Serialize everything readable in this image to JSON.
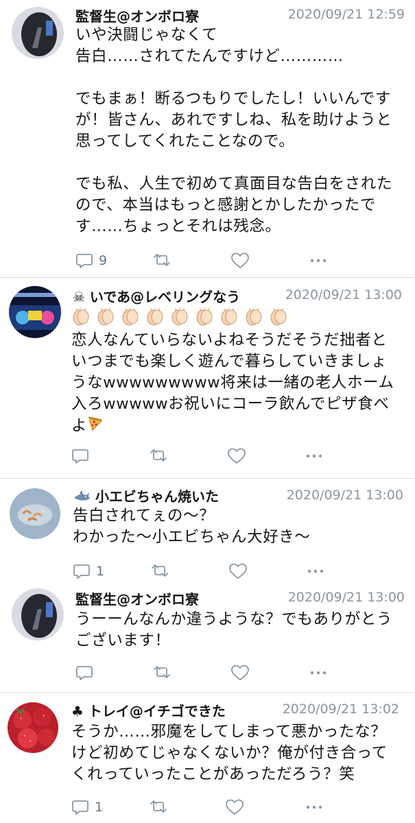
{
  "tweets": [
    {
      "name": "監督生@オンボロ寮",
      "time": "2020/09/21 12:59",
      "body": "いや決闘じゃなくて\n告白……されてたんですけど…………\n\nでもまぁ！断るつもりでしたし！いいんですが！皆さん、あれですしね、私を助けようと思ってしてくれたことなので。\n\nでも私、人生で初めて真面目な告白をされたので、本当はもっと感謝とかしたかったです……ちょっとそれは残念。",
      "reply_count": "9",
      "avatar_icon": "user-avatar-dark-icon"
    },
    {
      "name_prefix_icon": "skull-icon",
      "name": "いであ@レベリングなう",
      "time": "2020/09/21 13:00",
      "body_lead_icons": "clapping-hands-icon x9",
      "body": "恋人なんていらないよねそうだそうだ拙者といつまでも楽しく遊んで暮らしていきましょうなwwwwwwwww将来は一緒の老人ホーム入ろwwwwwお祝いにコーラ飲んでピザ食べよ",
      "body_tail_icon": "pizza-icon",
      "reply_count": "",
      "avatar_icon": "game-screen-avatar-icon"
    },
    {
      "name_prefix_icon": "shark-icon",
      "name": "小エビちゃん焼いた",
      "time": "2020/09/21 13:00",
      "body": "告白されてぇの〜？\nわかった〜小エビちゃん大好き〜",
      "reply_count": "1",
      "avatar_icon": "shrimp-plate-avatar-icon"
    },
    {
      "name": "監督生@オンボロ寮",
      "time": "2020/09/21 13:00",
      "body": "うーーんなんか違うような？でもありがとうございます！",
      "reply_count": "",
      "avatar_icon": "user-avatar-dark-icon"
    },
    {
      "name_prefix_icon": "club-suit-icon",
      "name": "トレイ@イチゴできた",
      "time": "2020/09/21 13:02",
      "body": "そうか……邪魔をしてしまって悪かったな？けど初めてじゃなくないか？俺が付き合ってくれっていったことがあっただろう？笑",
      "reply_count": "1",
      "avatar_icon": "strawberry-avatar-icon"
    }
  ],
  "icons": {
    "reply": "reply-icon",
    "retweet": "retweet-icon",
    "like": "like-icon",
    "more": "more-icon"
  },
  "colors": {
    "text": "#14171a",
    "timestamp": "#8a959e",
    "action": "#8899a6",
    "divider": "#d6dbe0"
  }
}
